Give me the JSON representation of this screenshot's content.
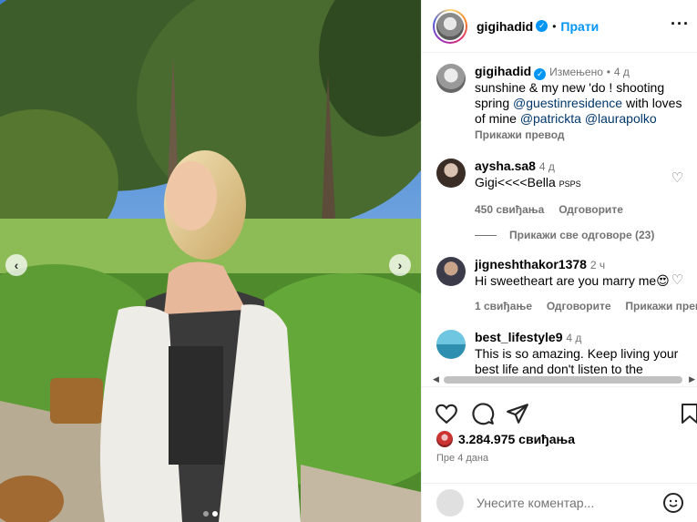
{
  "post": {
    "username": "gigihadid",
    "follow_label": "Прати",
    "more_label": "···"
  },
  "caption": {
    "username": "gigihadid",
    "edited": "Измењено",
    "sep": "•",
    "time": "4 д",
    "text_1": "sunshine & my new 'do ! shooting spring ",
    "mention_1": "@guestinresidence",
    "text_2": " with loves of mine ",
    "mention_2": "@patrickta",
    "mention_3": "@laurapolko",
    "translate": "Прикажи превод"
  },
  "comments": [
    {
      "username": "aysha.sa8",
      "time": "4 д",
      "text": "Gigi<<<<Bella",
      "small": "PSPS",
      "likes": "450 свиђања",
      "reply": "Одговорите"
    },
    {
      "username": "jigneshthakor1378",
      "time": "2 ч",
      "text": "Hi sweetheart are you marry me😍",
      "likes": "1 свиђање",
      "reply": "Одговорите",
      "translate": "Прикажи превод"
    },
    {
      "username": "best_lifestyle9",
      "time": "4 д",
      "text": "This is so amazing. Keep living your best life and don't listen to the"
    }
  ],
  "view_replies": "Прикажи све одговоре (23)",
  "likes_count": "3.284.975 свиђања",
  "posted_time": "Пре 4 дана",
  "add_comment_placeholder": "Унесите коментар...",
  "icons": [
    "heart-icon",
    "comment-icon",
    "share-icon",
    "save-icon",
    "emoji-icon",
    "verified-icon",
    "chevron-left-icon",
    "chevron-right-icon"
  ],
  "colors": {
    "link": "#0095f6",
    "mention": "#00376b",
    "muted": "#737373"
  }
}
